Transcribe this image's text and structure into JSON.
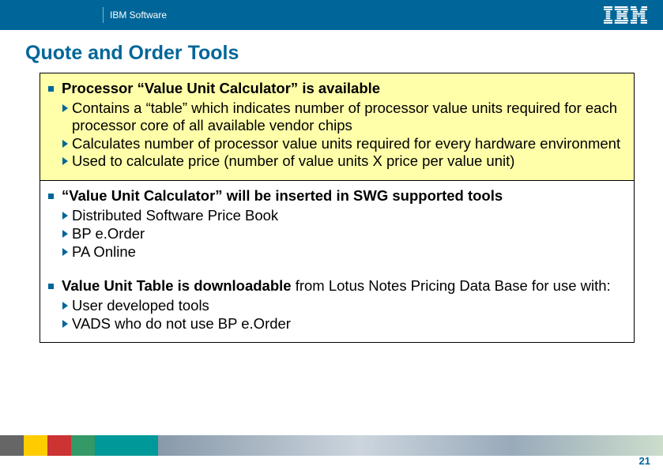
{
  "header": {
    "label": "IBM Software"
  },
  "title": "Quote and Order Tools",
  "sections": [
    {
      "heading_bold": "Processor “Value Unit Calculator” is available",
      "heading_rest": "",
      "subs": [
        "Contains a “table” which indicates number of processor value units required for each processor core of all available vendor chips",
        "Calculates number of processor value units required for every hardware environment",
        "Used to calculate price (number of value units X price per value unit)"
      ]
    },
    {
      "heading_bold": "“Value Unit Calculator” will be inserted in SWG supported tools",
      "heading_rest": "",
      "subs": [
        "Distributed Software Price Book",
        "BP e.Order",
        "PA Online"
      ]
    },
    {
      "heading_bold": "Value Unit Table is downloadable",
      "heading_rest": " from Lotus Notes Pricing Data Base for use with:",
      "subs": [
        "User developed tools",
        "VADS who do not use BP e.Order"
      ]
    }
  ],
  "page_number": "21"
}
